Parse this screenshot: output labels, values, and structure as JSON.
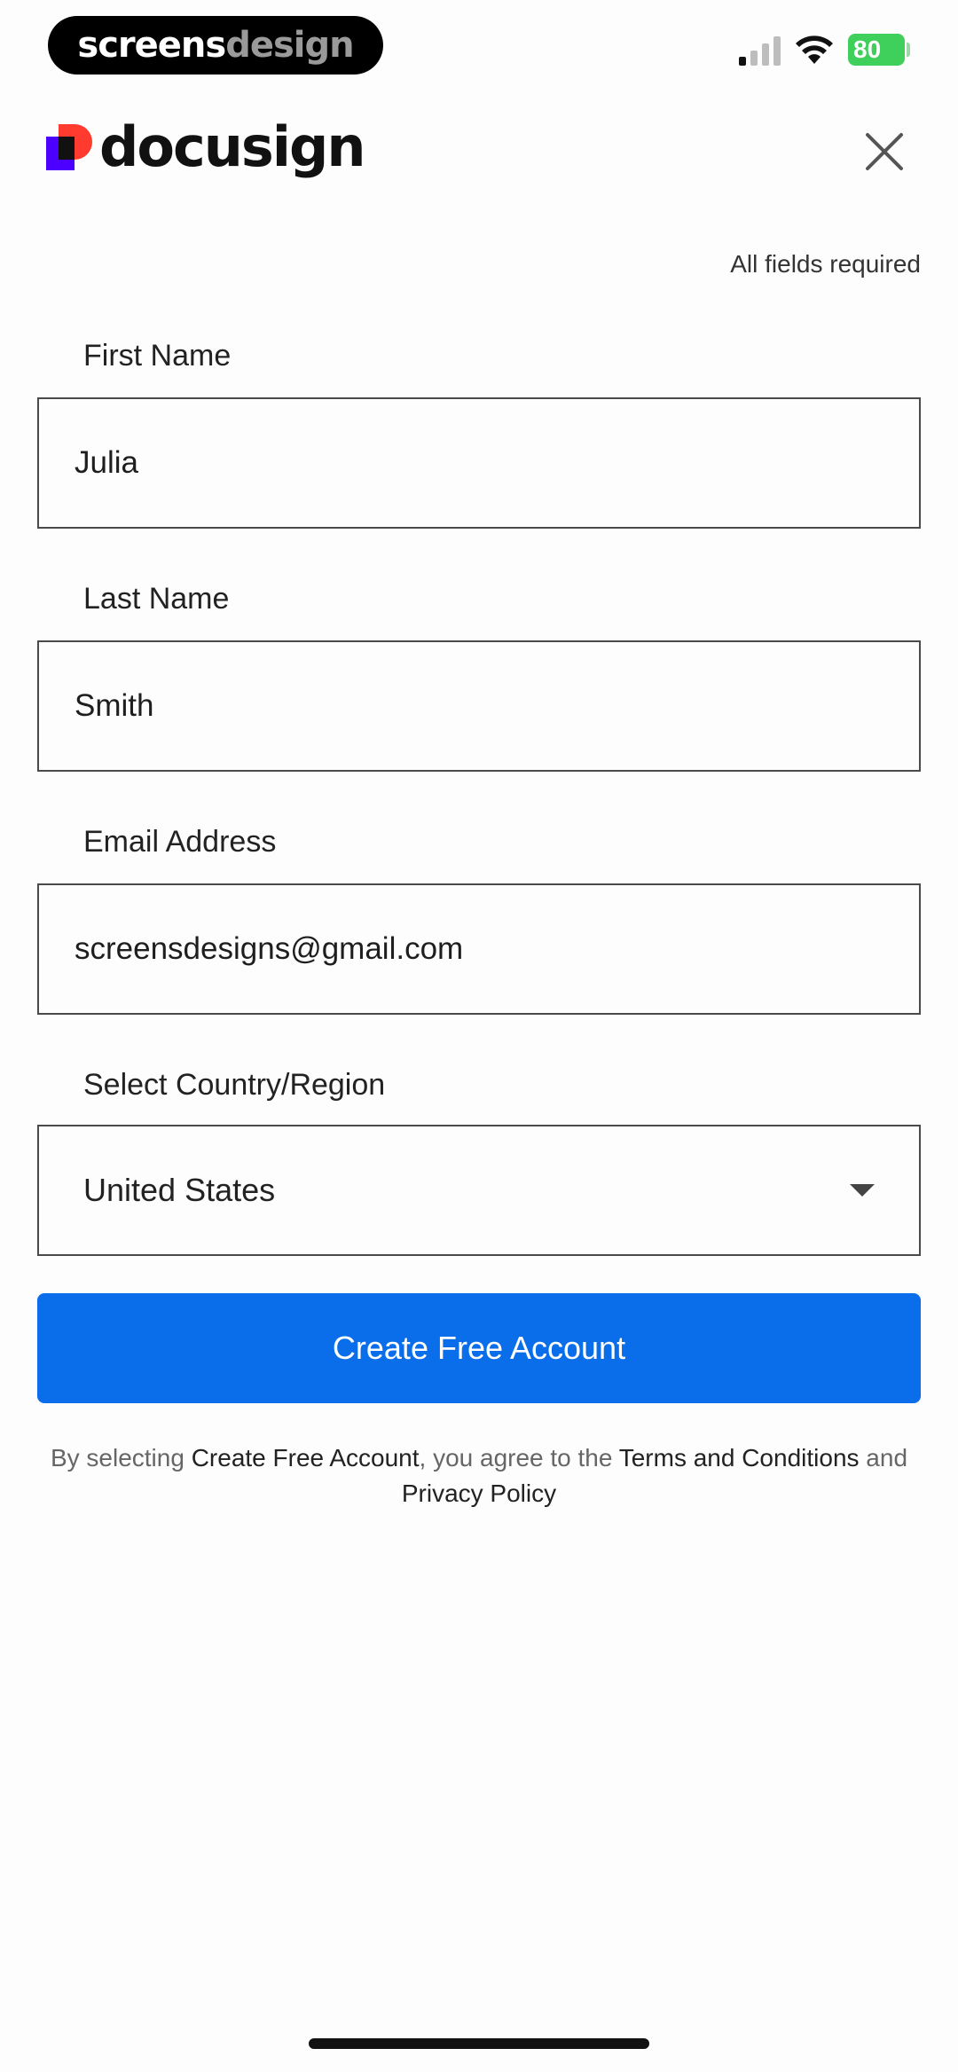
{
  "status_bar": {
    "brand_part1": "screens",
    "brand_part2": "design",
    "battery_level": "80"
  },
  "header": {
    "logo_text": "docusign",
    "brand_colors": {
      "purple": "#4c00ff",
      "red": "#ff3b30",
      "dark": "#111111"
    }
  },
  "form": {
    "required_note": "All fields required",
    "first_name": {
      "label": "First Name",
      "value": "Julia"
    },
    "last_name": {
      "label": "Last Name",
      "value": "Smith"
    },
    "email": {
      "label": "Email Address",
      "value": "screensdesigns@gmail.com"
    },
    "country": {
      "label": "Select Country/Region",
      "value": "United States"
    },
    "submit_label": "Create Free Account"
  },
  "legal": {
    "prefix": "By selecting ",
    "action": "Create Free Account",
    "middle": ", you agree to the ",
    "terms": "Terms and Conditions",
    "conj": " and",
    "privacy": "Privacy Policy"
  },
  "accent_color": "#0a6eea"
}
